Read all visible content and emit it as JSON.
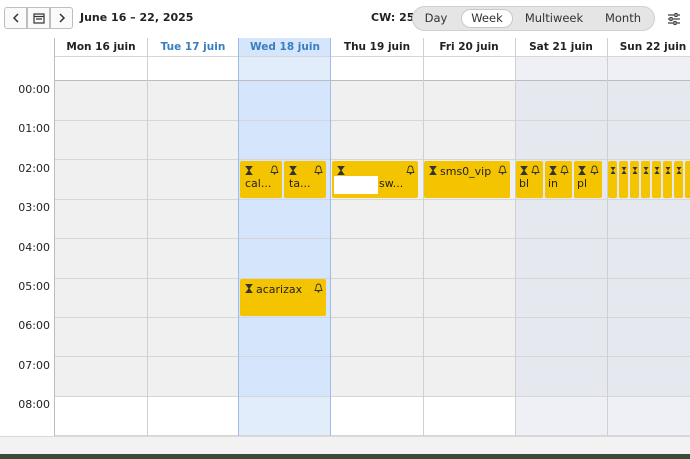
{
  "toolbar": {
    "prev_icon": "chevron-left-icon",
    "today_icon": "calendar-icon",
    "next_icon": "chevron-right-icon",
    "date_range": "June 16 – 22, 2025",
    "calendar_week": "CW: 25",
    "views": [
      "Day",
      "Week",
      "Multiweek",
      "Month"
    ],
    "active_view": "Week",
    "settings_icon": "settings-sliders-icon"
  },
  "days": [
    {
      "label": "Mon 16 juin",
      "today": false,
      "selected": false,
      "weekend": false
    },
    {
      "label": "Tue 17 juin",
      "today": true,
      "selected": false,
      "weekend": false
    },
    {
      "label": "Wed 18 juin",
      "today": false,
      "selected": true,
      "weekend": false
    },
    {
      "label": "Thu 19 juin",
      "today": false,
      "selected": false,
      "weekend": false
    },
    {
      "label": "Fri 20 juin",
      "today": false,
      "selected": false,
      "weekend": false
    },
    {
      "label": "Sat 21 juin",
      "today": false,
      "selected": false,
      "weekend": true
    },
    {
      "label": "Sun 22 juin",
      "today": false,
      "selected": false,
      "weekend": true
    }
  ],
  "times": [
    "00:00",
    "01:00",
    "02:00",
    "03:00",
    "04:00",
    "05:00",
    "06:00",
    "07:00",
    "08:00"
  ],
  "events": [
    {
      "label": "cal...",
      "day": "Wed 18 juin",
      "time": "02:00"
    },
    {
      "label": "ta...",
      "day": "Wed 18 juin",
      "time": "02:00"
    },
    {
      "label": "sw...",
      "day": "Thu 19 juin",
      "time": "02:00"
    },
    {
      "label": "sms0_vip",
      "day": "Fri 20 juin",
      "time": "02:00"
    },
    {
      "label": "bl",
      "day": "Sat 21 juin",
      "time": "02:00"
    },
    {
      "label": "in",
      "day": "Sat 21 juin",
      "time": "02:00"
    },
    {
      "label": "pl",
      "day": "Sat 21 juin",
      "time": "02:00"
    },
    {
      "label": "acarizax",
      "day": "Wed 18 juin",
      "time": "05:00"
    }
  ],
  "colors": {
    "event": "#f5c400",
    "selected_day": "#d5e5fb",
    "weekend": "#e6e8ef",
    "weekday": "#f0f0f0",
    "today_text": "#3a7ebf"
  }
}
